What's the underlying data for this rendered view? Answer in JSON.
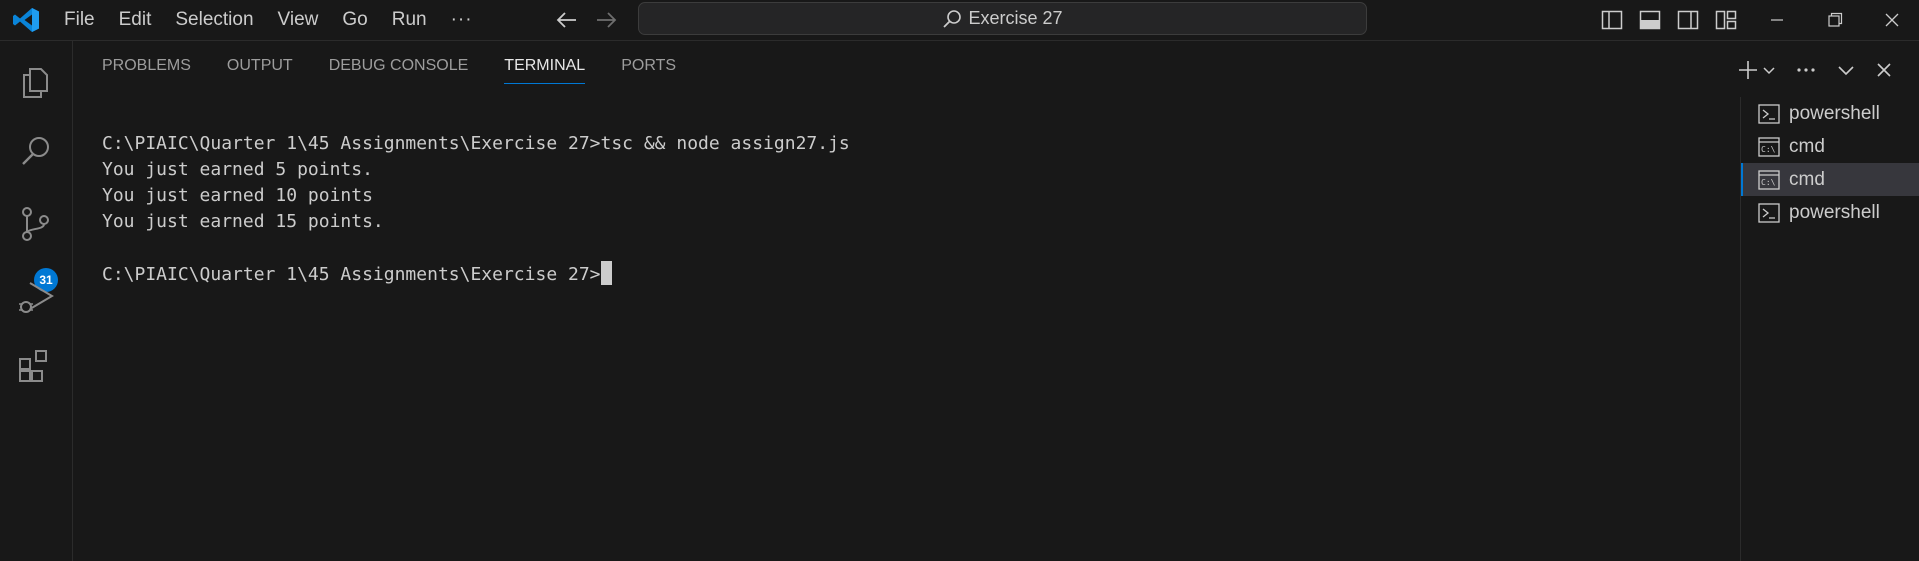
{
  "menu": {
    "file": "File",
    "edit": "Edit",
    "selection": "Selection",
    "view": "View",
    "go": "Go",
    "run": "Run",
    "more": "···"
  },
  "search": {
    "text": "Exercise 27"
  },
  "activity": {
    "badge": "31"
  },
  "panel": {
    "tabs": [
      "PROBLEMS",
      "OUTPUT",
      "DEBUG CONSOLE",
      "TERMINAL",
      "PORTS"
    ],
    "active_tab": "TERMINAL"
  },
  "terminal": {
    "lines": [
      "C:\\PIAIC\\Quarter 1\\45 Assignments\\Exercise 27>tsc && node assign27.js",
      "You just earned 5 points.",
      "You just earned 10 points",
      "You just earned 15 points.",
      "",
      "C:\\PIAIC\\Quarter 1\\45 Assignments\\Exercise 27>"
    ]
  },
  "terminals": [
    {
      "label": "powershell",
      "icon": "powershell-icon"
    },
    {
      "label": "cmd",
      "icon": "cmd-icon"
    },
    {
      "label": "cmd",
      "icon": "cmd-icon",
      "selected": true
    },
    {
      "label": "powershell",
      "icon": "powershell-icon"
    }
  ],
  "colors": {
    "accent": "#0078d4",
    "background": "#181818",
    "text": "#cccccc"
  }
}
